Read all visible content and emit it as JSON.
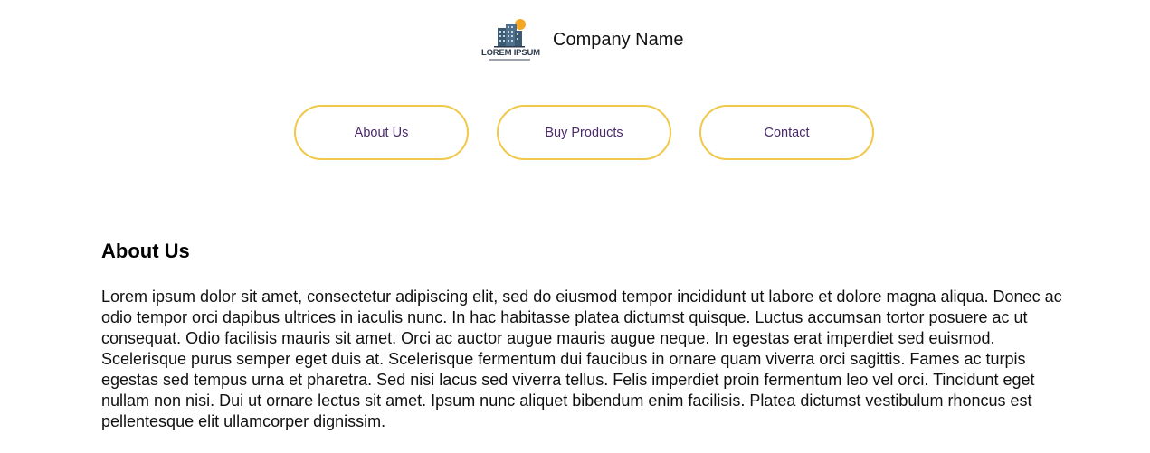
{
  "header": {
    "logo_text": "LOREM IPSUM",
    "company_name": "Company Name"
  },
  "nav": {
    "items": [
      {
        "label": "About Us"
      },
      {
        "label": "Buy Products"
      },
      {
        "label": "Contact"
      }
    ]
  },
  "about": {
    "title": "About Us",
    "body": "Lorem ipsum dolor sit amet, consectetur adipiscing elit, sed do eiusmod tempor incididunt ut labore et dolore magna aliqua. Donec ac odio tempor orci dapibus ultrices in iaculis nunc. In hac habitasse platea dictumst quisque. Luctus accumsan tortor posuere ac ut consequat. Odio facilisis mauris sit amet. Orci ac auctor augue mauris augue neque. In egestas erat imperdiet sed euismod. Scelerisque purus semper eget duis at. Scelerisque fermentum dui faucibus in ornare quam viverra orci sagittis. Fames ac turpis egestas sed tempus urna et pharetra. Sed nisi lacus sed viverra tellus. Felis imperdiet proin fermentum leo vel orci. Tincidunt eget nullam non nisi. Dui ut ornare lectus sit amet. Ipsum nunc aliquet bibendum enim facilisis. Platea dictumst vestibulum rhoncus est pellentesque elit ullamcorper dignissim."
  },
  "colors": {
    "button_border": "#f0c84a",
    "button_text": "#4b2a6b",
    "logo_sun": "#f5a623",
    "logo_building": "#3d5a73"
  }
}
